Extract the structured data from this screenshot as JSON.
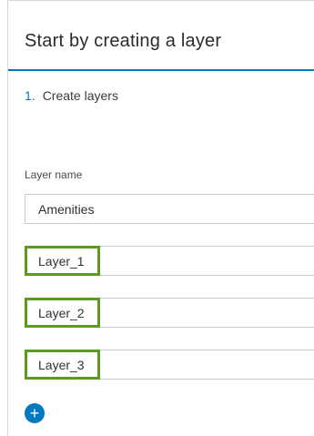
{
  "panel": {
    "title": "Start by creating a layer",
    "step": {
      "number": "1.",
      "label": "Create layers"
    },
    "field_label": "Layer name",
    "first_value": "Amenities",
    "layers": [
      "Layer_1",
      "Layer_2",
      "Layer_3"
    ],
    "add_button": "+"
  },
  "colors": {
    "accent": "#0079c1",
    "highlight": "#5a9a21"
  },
  "icons": {
    "add": "plus-icon"
  }
}
